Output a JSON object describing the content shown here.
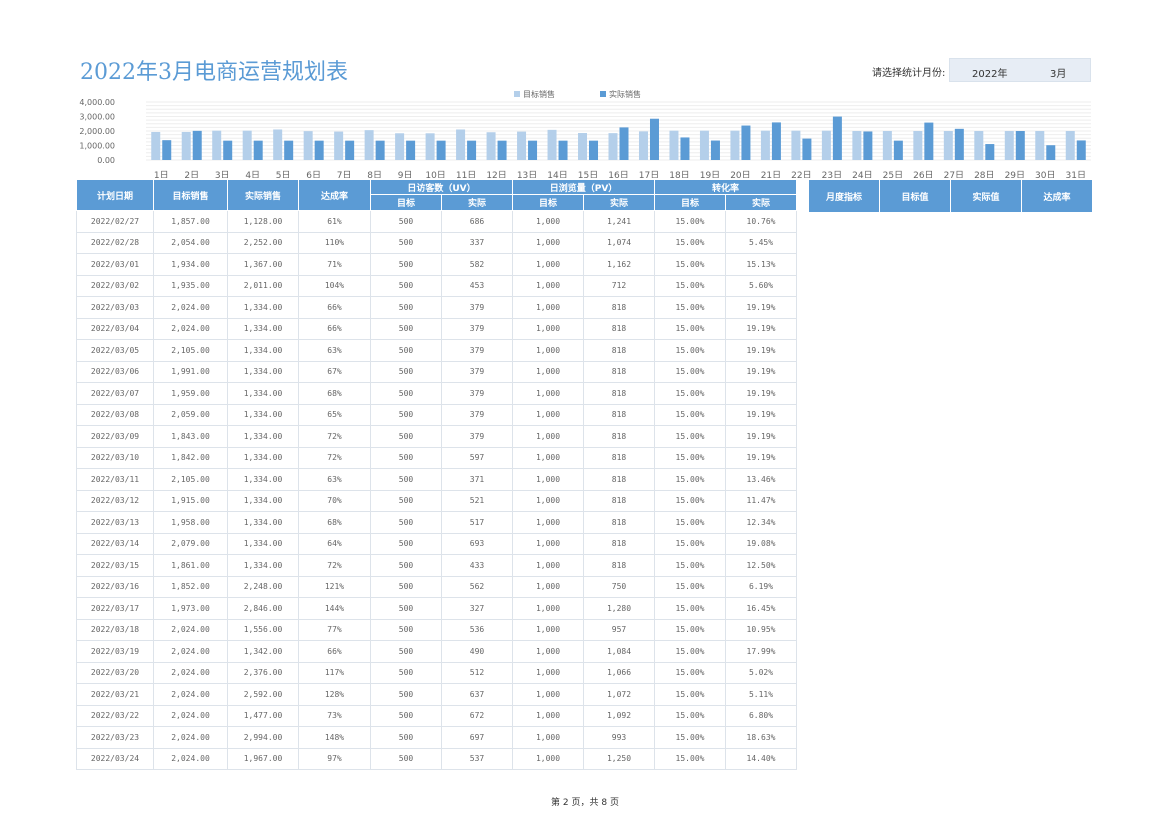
{
  "title": "2022年3月电商运营规划表",
  "selector": {
    "label": "请选择统计月份:",
    "year": "2022年",
    "month": "3月"
  },
  "colors": {
    "accent": "#5b9bd5",
    "target_bar": "#b4cfea",
    "actual_bar": "#5b9bd5"
  },
  "chart_data": {
    "type": "bar",
    "categories": [
      "1日",
      "2日",
      "3日",
      "4日",
      "5日",
      "6日",
      "7日",
      "8日",
      "9日",
      "10日",
      "11日",
      "12日",
      "13日",
      "14日",
      "15日",
      "16日",
      "17日",
      "18日",
      "19日",
      "20日",
      "21日",
      "22日",
      "23日",
      "24日",
      "25日",
      "26日",
      "27日",
      "28日",
      "29日",
      "30日",
      "31日"
    ],
    "series": [
      {
        "name": "目标销售",
        "values": [
          1934,
          1935,
          2024,
          2024,
          2105,
          1991,
          1959,
          2059,
          1843,
          1842,
          2105,
          1915,
          1958,
          2079,
          1861,
          1852,
          1973,
          2024,
          2024,
          2024,
          2024,
          2024,
          2024,
          2000,
          2000,
          2000,
          2000,
          2000,
          2000,
          2000,
          2000
        ]
      },
      {
        "name": "实际销售",
        "values": [
          1367,
          2011,
          1334,
          1334,
          1334,
          1334,
          1334,
          1334,
          1334,
          1334,
          1334,
          1334,
          1334,
          1334,
          1334,
          2248,
          2846,
          1556,
          1342,
          2376,
          2592,
          1477,
          2994,
          1967,
          1334,
          2580,
          2150,
          1100,
          2000,
          1020,
          1350
        ]
      }
    ],
    "ylim": [
      0,
      4000
    ],
    "yticks": [
      "0.00",
      "1,000.00",
      "2,000.00",
      "3,000.00",
      "4,000.00"
    ],
    "legend_position": "top-center",
    "grid": true
  },
  "table": {
    "headers": {
      "date": "计划日期",
      "target_sales": "目标销售",
      "actual_sales": "实际销售",
      "rate": "达成率",
      "uv": "日访客数（UV）",
      "pv": "日浏览量（PV）",
      "conv": "转化率",
      "sub_target": "目标",
      "sub_actual": "实际"
    },
    "rows": [
      [
        "2022/02/27",
        "1,857.00",
        "1,128.00",
        "61%",
        "500",
        "686",
        "1,000",
        "1,241",
        "15.00%",
        "10.76%"
      ],
      [
        "2022/02/28",
        "2,054.00",
        "2,252.00",
        "110%",
        "500",
        "337",
        "1,000",
        "1,074",
        "15.00%",
        "5.45%"
      ],
      [
        "2022/03/01",
        "1,934.00",
        "1,367.00",
        "71%",
        "500",
        "582",
        "1,000",
        "1,162",
        "15.00%",
        "15.13%"
      ],
      [
        "2022/03/02",
        "1,935.00",
        "2,011.00",
        "104%",
        "500",
        "453",
        "1,000",
        "712",
        "15.00%",
        "5.60%"
      ],
      [
        "2022/03/03",
        "2,024.00",
        "1,334.00",
        "66%",
        "500",
        "379",
        "1,000",
        "818",
        "15.00%",
        "19.19%"
      ],
      [
        "2022/03/04",
        "2,024.00",
        "1,334.00",
        "66%",
        "500",
        "379",
        "1,000",
        "818",
        "15.00%",
        "19.19%"
      ],
      [
        "2022/03/05",
        "2,105.00",
        "1,334.00",
        "63%",
        "500",
        "379",
        "1,000",
        "818",
        "15.00%",
        "19.19%"
      ],
      [
        "2022/03/06",
        "1,991.00",
        "1,334.00",
        "67%",
        "500",
        "379",
        "1,000",
        "818",
        "15.00%",
        "19.19%"
      ],
      [
        "2022/03/07",
        "1,959.00",
        "1,334.00",
        "68%",
        "500",
        "379",
        "1,000",
        "818",
        "15.00%",
        "19.19%"
      ],
      [
        "2022/03/08",
        "2,059.00",
        "1,334.00",
        "65%",
        "500",
        "379",
        "1,000",
        "818",
        "15.00%",
        "19.19%"
      ],
      [
        "2022/03/09",
        "1,843.00",
        "1,334.00",
        "72%",
        "500",
        "379",
        "1,000",
        "818",
        "15.00%",
        "19.19%"
      ],
      [
        "2022/03/10",
        "1,842.00",
        "1,334.00",
        "72%",
        "500",
        "597",
        "1,000",
        "818",
        "15.00%",
        "19.19%"
      ],
      [
        "2022/03/11",
        "2,105.00",
        "1,334.00",
        "63%",
        "500",
        "371",
        "1,000",
        "818",
        "15.00%",
        "13.46%"
      ],
      [
        "2022/03/12",
        "1,915.00",
        "1,334.00",
        "70%",
        "500",
        "521",
        "1,000",
        "818",
        "15.00%",
        "11.47%"
      ],
      [
        "2022/03/13",
        "1,958.00",
        "1,334.00",
        "68%",
        "500",
        "517",
        "1,000",
        "818",
        "15.00%",
        "12.34%"
      ],
      [
        "2022/03/14",
        "2,079.00",
        "1,334.00",
        "64%",
        "500",
        "693",
        "1,000",
        "818",
        "15.00%",
        "19.08%"
      ],
      [
        "2022/03/15",
        "1,861.00",
        "1,334.00",
        "72%",
        "500",
        "433",
        "1,000",
        "818",
        "15.00%",
        "12.50%"
      ],
      [
        "2022/03/16",
        "1,852.00",
        "2,248.00",
        "121%",
        "500",
        "562",
        "1,000",
        "750",
        "15.00%",
        "6.19%"
      ],
      [
        "2022/03/17",
        "1,973.00",
        "2,846.00",
        "144%",
        "500",
        "327",
        "1,000",
        "1,280",
        "15.00%",
        "16.45%"
      ],
      [
        "2022/03/18",
        "2,024.00",
        "1,556.00",
        "77%",
        "500",
        "536",
        "1,000",
        "957",
        "15.00%",
        "10.95%"
      ],
      [
        "2022/03/19",
        "2,024.00",
        "1,342.00",
        "66%",
        "500",
        "490",
        "1,000",
        "1,084",
        "15.00%",
        "17.99%"
      ],
      [
        "2022/03/20",
        "2,024.00",
        "2,376.00",
        "117%",
        "500",
        "512",
        "1,000",
        "1,066",
        "15.00%",
        "5.02%"
      ],
      [
        "2022/03/21",
        "2,024.00",
        "2,592.00",
        "128%",
        "500",
        "637",
        "1,000",
        "1,072",
        "15.00%",
        "5.11%"
      ],
      [
        "2022/03/22",
        "2,024.00",
        "1,477.00",
        "73%",
        "500",
        "672",
        "1,000",
        "1,092",
        "15.00%",
        "6.80%"
      ],
      [
        "2022/03/23",
        "2,024.00",
        "2,994.00",
        "148%",
        "500",
        "697",
        "1,000",
        "993",
        "15.00%",
        "18.63%"
      ],
      [
        "2022/03/24",
        "2,024.00",
        "1,967.00",
        "97%",
        "500",
        "537",
        "1,000",
        "1,250",
        "15.00%",
        "14.40%"
      ]
    ]
  },
  "summary": {
    "headers": [
      "月度指标",
      "目标值",
      "实际值",
      "达成率"
    ]
  },
  "footer": "第 2 页，共 8 页"
}
